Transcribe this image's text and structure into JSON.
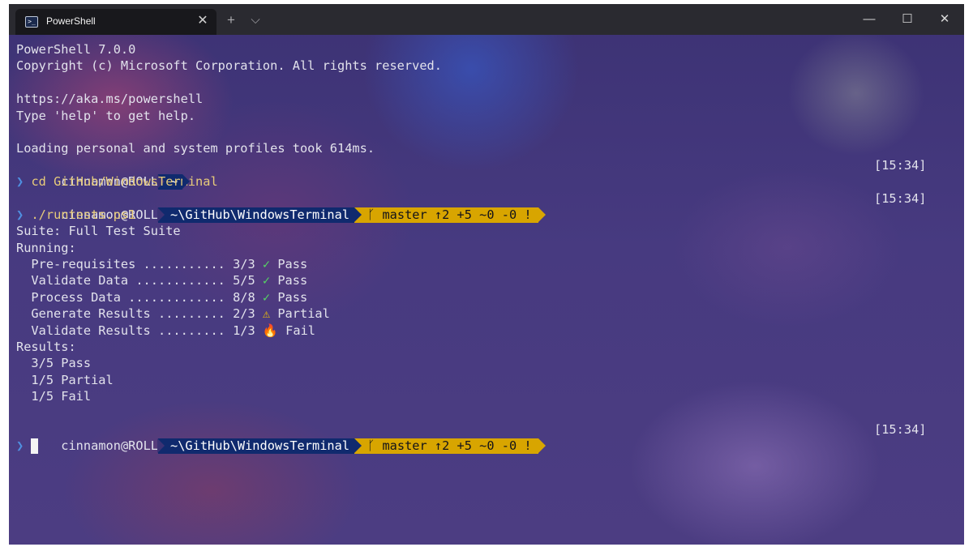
{
  "window": {
    "tab_title": "PowerShell",
    "tab_close": "✕",
    "new_tab": "+",
    "dropdown": "⌵",
    "minimize": "—",
    "maximize": "☐",
    "close": "✕"
  },
  "terminal": {
    "header": [
      "PowerShell 7.0.0",
      "Copyright (c) Microsoft Corporation. All rights reserved.",
      "",
      "https://aka.ms/powershell",
      "Type 'help' to get help.",
      "",
      "Loading personal and system profiles took 614ms."
    ],
    "user_host": "cinnamon@ROLL",
    "prompt_char": "❯",
    "path_home": "~",
    "path_repo": "~\\GitHub\\WindowsTerminal",
    "git_branch_icon": "ᚴ",
    "git_status": "master ↑2 +5 ~0 -0 !",
    "time": "[15:34]",
    "cmd1": "cd GitHub/WindowsTerminal",
    "cmd2": "./runtests.ps1",
    "suite_line": "Suite: Full Test Suite",
    "running_label": "Running:",
    "tests": [
      {
        "name": "  Pre-requisites ........... 3/3 ",
        "icon": "✓",
        "icon_name": "check-icon",
        "result": " Pass",
        "status": "pass"
      },
      {
        "name": "  Validate Data ............ 5/5 ",
        "icon": "✓",
        "icon_name": "check-icon",
        "result": " Pass",
        "status": "pass"
      },
      {
        "name": "  Process Data ............. 8/8 ",
        "icon": "✓",
        "icon_name": "check-icon",
        "result": " Pass",
        "status": "pass"
      },
      {
        "name": "  Generate Results ......... 2/3 ",
        "icon": "⚠",
        "icon_name": "warning-icon",
        "result": " Partial",
        "status": "partial"
      },
      {
        "name": "  Validate Results ......... 1/3 ",
        "icon": "🔥",
        "icon_name": "fire-icon",
        "result": " Fail",
        "status": "fail"
      }
    ],
    "results_label": "Results:",
    "results": [
      "  3/5 Pass",
      "  1/5 Partial",
      "  1/5 Fail"
    ]
  },
  "colors": {
    "path_segment": "#102a6e",
    "git_segment": "#d8a500",
    "prompt_arrow": "#4f8fe0",
    "command_text": "#e8cc7a",
    "pass": "#56d364",
    "warning": "#f2c200",
    "fail": "#ff7a1a"
  }
}
